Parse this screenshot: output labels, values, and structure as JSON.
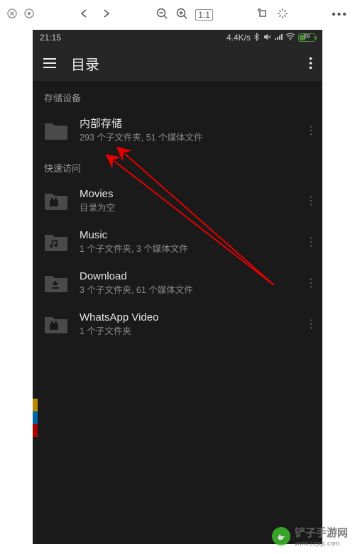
{
  "browser_toolbar": {
    "close": "close",
    "stop": "stop",
    "back": "back",
    "forward": "forward",
    "zoom_out": "zoom-out",
    "zoom_in": "zoom-in",
    "actual": "1:1",
    "rotate": "rotate",
    "magic": "wand",
    "more": "more"
  },
  "status_bar": {
    "time": "21:15",
    "net_speed": "4.4K/s",
    "battery_pct": "39"
  },
  "app_bar": {
    "title": "目录"
  },
  "sections": [
    {
      "header": "存储设备",
      "items": [
        {
          "icon": "folder",
          "title": "内部存储",
          "sub": "293 个子文件夹, 51 个媒体文件"
        }
      ]
    },
    {
      "header": "快速访问",
      "items": [
        {
          "icon": "video-folder",
          "title": "Movies",
          "sub": "目录为空"
        },
        {
          "icon": "music-folder",
          "title": "Music",
          "sub": "1 个子文件夹, 3 个媒体文件"
        },
        {
          "icon": "download-folder",
          "title": "Download",
          "sub": "3 个子文件夹, 61 个媒体文件"
        },
        {
          "icon": "video-folder",
          "title": "WhatsApp Video",
          "sub": "1 个子文件夹"
        }
      ]
    }
  ],
  "watermark": {
    "text": "铲子手游网",
    "url": "www.czjxjc.com"
  },
  "edge_colors": [
    "#b88a00",
    "#0066aa",
    "#aa0000"
  ]
}
